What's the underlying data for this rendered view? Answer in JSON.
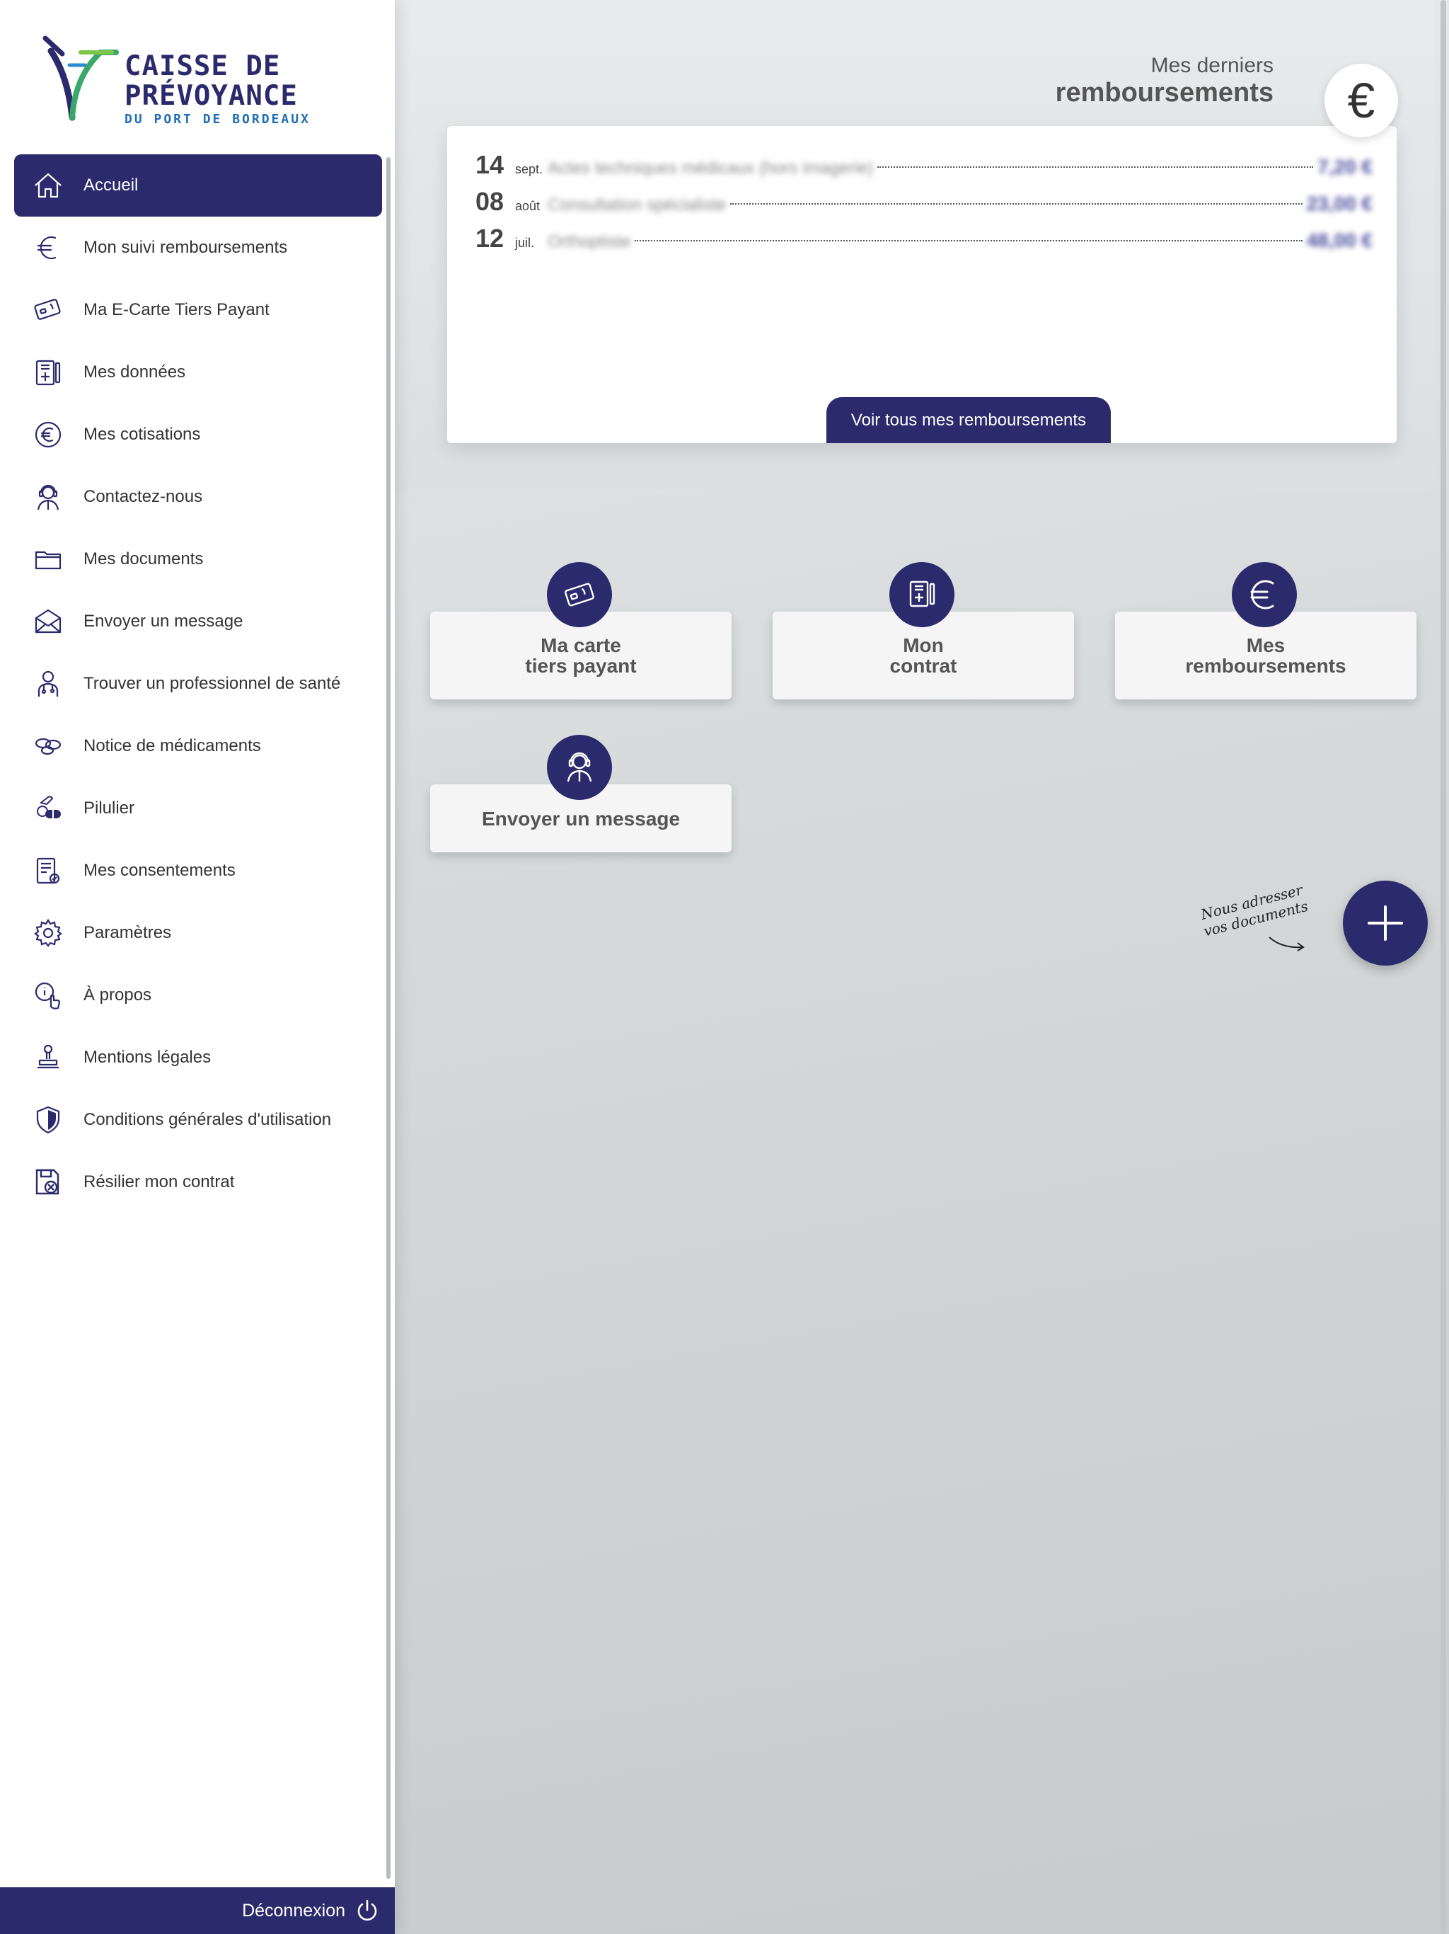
{
  "brand": {
    "line1": "CAISSE DE",
    "line2": "PRÉVOYANCE",
    "line3": "DU PORT DE BORDEAUX",
    "primary_color": "#2a2a6c"
  },
  "sidebar": {
    "items": [
      {
        "label": "Accueil",
        "icon": "home-icon",
        "active": true
      },
      {
        "label": "Mon suivi remboursements",
        "icon": "euro-icon"
      },
      {
        "label": "Ma E-Carte Tiers Payant",
        "icon": "card-icon"
      },
      {
        "label": "Mes données",
        "icon": "medical-record-icon"
      },
      {
        "label": "Mes cotisations",
        "icon": "euro-circle-icon"
      },
      {
        "label": "Contactez-nous",
        "icon": "headset-agent-icon"
      },
      {
        "label": "Mes documents",
        "icon": "folder-icon"
      },
      {
        "label": "Envoyer un message",
        "icon": "envelope-icon"
      },
      {
        "label": "Trouver un professionnel de santé",
        "icon": "doctor-icon"
      },
      {
        "label": "Notice de médicaments",
        "icon": "pills-icon"
      },
      {
        "label": "Pilulier",
        "icon": "capsule-icon"
      },
      {
        "label": "Mes consentements",
        "icon": "consent-document-icon"
      },
      {
        "label": "Paramètres",
        "icon": "gear-icon"
      },
      {
        "label": "À propos",
        "icon": "info-touch-icon"
      },
      {
        "label": "Mentions légales",
        "icon": "stamp-icon"
      },
      {
        "label": "Conditions générales d'utilisation",
        "icon": "shield-icon"
      },
      {
        "label": "Résilier mon contrat",
        "icon": "cancel-contract-icon"
      }
    ],
    "logout_label": "Déconnexion"
  },
  "reimbursements": {
    "title_line1": "Mes derniers",
    "title_line2": "remboursements",
    "currency_symbol": "€",
    "rows": [
      {
        "day": "14",
        "month": "sept.",
        "label": "Actes techniques médicaux (hors imagerie)",
        "amount": "7,20 €"
      },
      {
        "day": "08",
        "month": "août",
        "label": "Consultation spécialiste",
        "amount": "23,00 €"
      },
      {
        "day": "12",
        "month": "juil.",
        "label": "Orthoptiste",
        "amount": "48,00 €"
      }
    ],
    "see_all_label": "Voir tous mes remboursements"
  },
  "tiles": [
    {
      "label": "Ma carte\ntiers payant",
      "icon": "card-icon"
    },
    {
      "label": "Mon\ncontrat",
      "icon": "medical-record-icon"
    },
    {
      "label": "Mes\nremboursements",
      "icon": "euro-icon"
    },
    {
      "label": "Envoyer un message",
      "icon": "headset-agent-icon"
    }
  ],
  "fab": {
    "note_line1": "Nous adresser",
    "note_line2": "vos documents",
    "icon": "plus-icon"
  }
}
